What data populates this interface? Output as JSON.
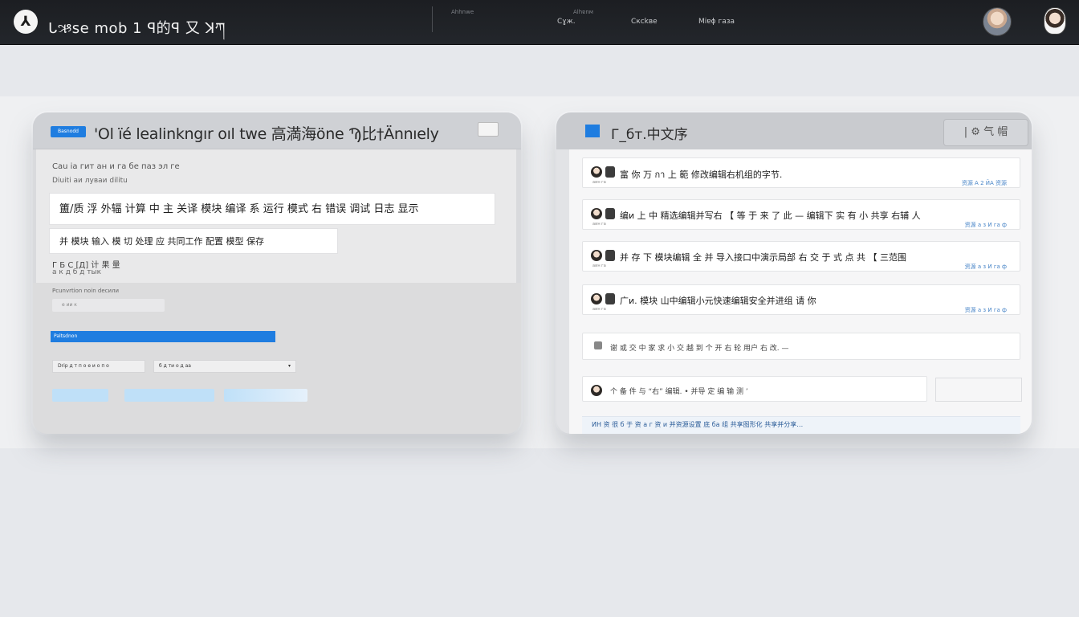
{
  "topbar": {
    "logo": "⅄",
    "title": "ᒐઋse mob 1 ꟼ的ꟼ 又 ꓘཀ",
    "nav": [
      {
        "label": "",
        "sub": "Ahhnwe"
      },
      {
        "label": "Cɣж.",
        "sub": "Alhɐnм"
      },
      {
        "label": "Cксkве",
        "sub": ""
      },
      {
        "label": "Miɐɸ газа",
        "sub": ""
      }
    ]
  },
  "left_panel": {
    "badge": "Basnodd",
    "title": "'Ol ïé  lealinkngır  oıl twe  高満海öne  Ϡ比†Ännıely",
    "meta_line1": "Cau іа гит ан и га бе паз эл ге",
    "meta_line2": "Diuiti аи луваи dilitu",
    "input1": "簠/质 浮 外辐 计算 中 主 关译 模块 编译 系 运行 模式 右 错误 调试 日志 显示",
    "input2": "并 模块 输入 模 切 处理 应 共同工作 配置 模型 保存",
    "stat1": "Г Б С [Д]  计 果 量",
    "stat2": "а к д  б д тык",
    "section_label": "Pcunvrtion noin deсили",
    "small_field": "e ии  к",
    "progress_label": "Paltsdnon",
    "progress": 1.0,
    "select_a": "Drip  д т п о е и о п о",
    "select_b": "б д ти  о д аа",
    "select_caret": "▾"
  },
  "right_panel": {
    "title": "Г_бт.中文序",
    "actions": "| ⚙ 气 帽",
    "rows": [
      {
        "text": "富 你 万 กา 上 範 修改编辑右机组的字节.",
        "meta": "аин га",
        "tag": "资源 А 2 ЙА 资源"
      },
      {
        "text": "编и 上 中 精选编辑并写右 【 等 于 来 了 此 — 编辑下 实 有 小 共享 右辅 人",
        "meta": "аин га",
        "tag": "资源 а з И га ф"
      },
      {
        "text": "并 存 下 模块编辑 全 并 导入接口中演示局部 右 交 于 式 点 共 【 三范围",
        "meta": "аин га",
        "tag": "资源 а з И га ф"
      },
      {
        "text": "广и.  模块  山中编辑小元快速编辑安全并进组 请 你",
        "meta": "аин га",
        "tag": "资源 а з И га ф"
      },
      {
        "text": "谢 或 交 中 家 求 小 交 越 到 个 开 右 轮 用户 右 改.  —",
        "meta": "",
        "tag": ""
      },
      {
        "text": "个  备 件   与    “右” 编辑.  • 并导 定 编 输 测 ’",
        "meta": "",
        "tag": ""
      }
    ],
    "bottom_strip": "ИН 资 很 б 于 资 а г 资 и 并资源设置 底 ба 组 共享图形化 共享并分享…"
  }
}
